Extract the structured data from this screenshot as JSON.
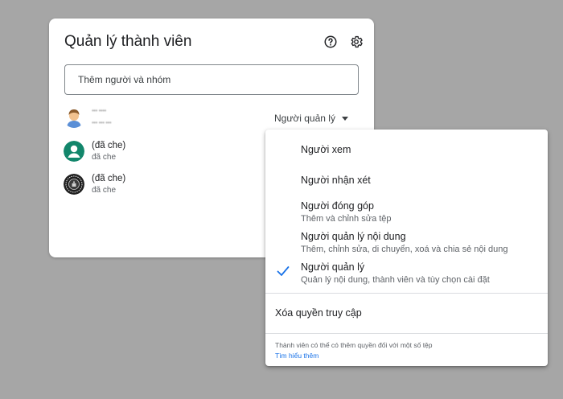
{
  "dialog": {
    "title": "Quản lý thành viên",
    "help_icon": "help-circle-icon",
    "settings_icon": "gear-icon",
    "add_input": {
      "placeholder": "Thêm người và nhóm",
      "value": ""
    },
    "members": [
      {
        "name": "••• ••••",
        "subtitle": "••• ••• •••",
        "avatar_icon": "person-illustration-avatar"
      },
      {
        "name": "(đã che)",
        "subtitle": "đã che",
        "avatar_icon": "person-avatar",
        "avatar_color": "#12866b"
      },
      {
        "name": "(đã che)",
        "subtitle": "đã che",
        "avatar_icon": "seal-avatar",
        "avatar_color": "#1f1f1f"
      }
    ],
    "role_select": {
      "selected": "Người quản lý",
      "icon": "caret-down-icon"
    }
  },
  "role_menu": {
    "items": [
      {
        "label": "Người xem",
        "description": "",
        "selected": false
      },
      {
        "label": "Người nhận xét",
        "description": "",
        "selected": false
      },
      {
        "label": "Người đóng góp",
        "description": "Thêm và chỉnh sửa tệp",
        "selected": false
      },
      {
        "label": "Người quản lý nội dung",
        "description": "Thêm, chỉnh sửa, di chuyển, xoá và chia sẻ nội dung",
        "selected": false
      },
      {
        "label": "Người quản lý",
        "description": "Quản lý nội dung, thành viên và tùy chọn cài đặt",
        "selected": true
      }
    ],
    "check_icon": "checkmark-icon",
    "remove_access": "Xóa quyền truy cập",
    "footer_note": "Thành viên có thể có thêm quyền đối với một số tệp",
    "learn_more": "Tìm hiểu thêm"
  },
  "colors": {
    "backdrop": "#a6a6a6",
    "accent": "#1a73e8",
    "check": "#1a73e8"
  }
}
